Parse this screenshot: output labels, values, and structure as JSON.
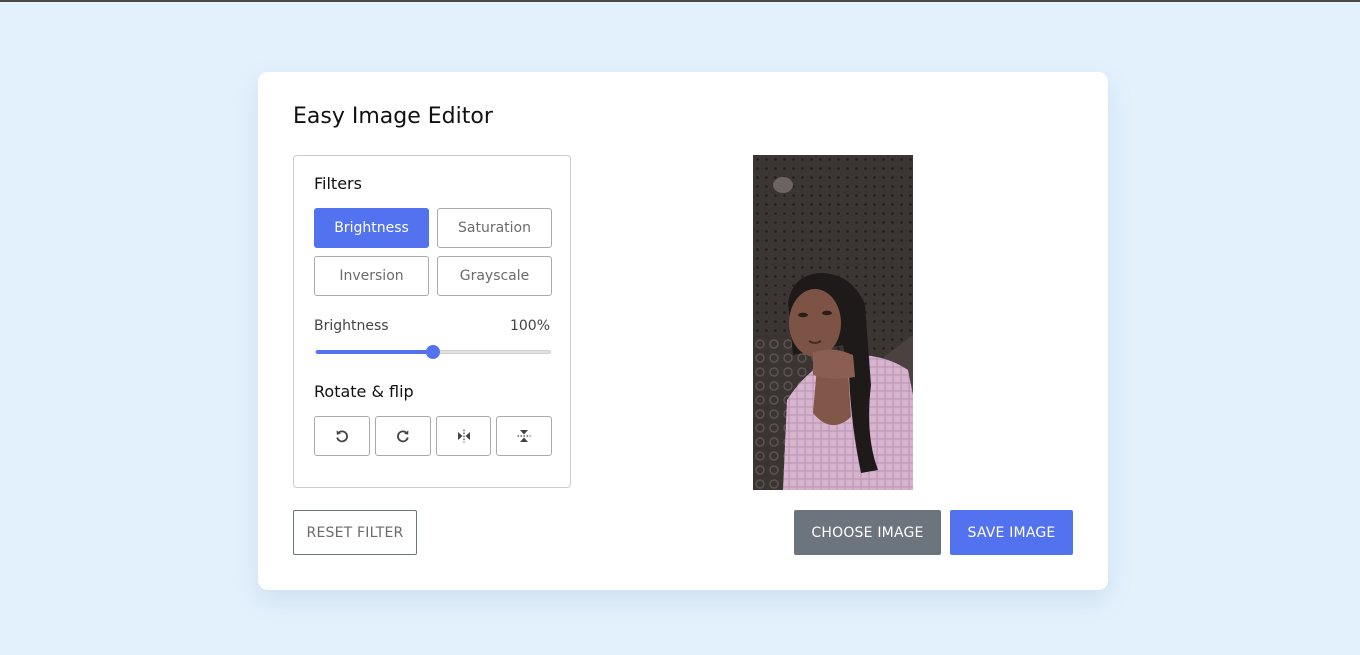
{
  "app": {
    "title": "Easy Image Editor"
  },
  "filters": {
    "heading": "Filters",
    "options": [
      {
        "label": "Brightness",
        "active": true
      },
      {
        "label": "Saturation",
        "active": false
      },
      {
        "label": "Inversion",
        "active": false
      },
      {
        "label": "Grayscale",
        "active": false
      }
    ]
  },
  "slider": {
    "name": "Brightness",
    "value_text": "100%",
    "level_fraction": 0.5
  },
  "rotate": {
    "heading": "Rotate & flip",
    "buttons": [
      {
        "icon": "rotate-left-icon"
      },
      {
        "icon": "rotate-right-icon"
      },
      {
        "icon": "flip-horizontal-icon"
      },
      {
        "icon": "flip-vertical-icon"
      }
    ]
  },
  "actions": {
    "reset_label": "RESET FILTER",
    "choose_label": "CHOOSE IMAGE",
    "save_label": "SAVE IMAGE"
  },
  "colors": {
    "accent": "#5372f0",
    "secondary": "#6c757d",
    "background": "#e3f1fd"
  }
}
